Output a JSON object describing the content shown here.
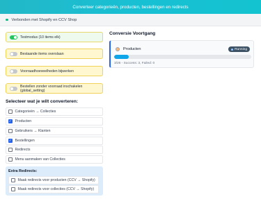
{
  "header": {
    "title": "Converteer categorieën, producten, bestellingen en redirects"
  },
  "connection": {
    "status_text": "Verbonden met Shopify en CCV Shop"
  },
  "settings": [
    {
      "label": "Testmodus (10 items elk)",
      "enabled": true
    },
    {
      "label": "Bestaande items overslaan",
      "enabled": false
    },
    {
      "label": "Voorraadhoeveelheden bijwerken",
      "enabled": false
    },
    {
      "label": "Bestellen zonder voorraad inschakelen (global_setting)",
      "enabled": false
    }
  ],
  "selection": {
    "title": "Selecteer wat je wilt converteren:",
    "options": [
      {
        "label": "Categorieën → Collecties",
        "checked": false
      },
      {
        "label": "Producten",
        "checked": true
      },
      {
        "label": "Gebruikers → Klanten",
        "checked": false
      },
      {
        "label": "Bestellingen",
        "checked": true
      },
      {
        "label": "Redirects",
        "checked": false
      },
      {
        "label": "Menu aanmaken van Collecties",
        "checked": false
      }
    ]
  },
  "extra_redirects": {
    "title": "Extra Redirects:",
    "options": [
      {
        "label": "Maak redirects voor producten (CCV → Shopify)",
        "checked": false
      },
      {
        "label": "Maak redirects voor collecties (CCV → Shopify)",
        "checked": false
      }
    ]
  },
  "conversion": {
    "title": "Conversie Voortgang",
    "task": {
      "label": "Producten",
      "status": "Running",
      "progress": 0.108,
      "stats": "3/26 - Success: 3, Failed: 0"
    }
  },
  "colors": {
    "header_start": "#22b8c8",
    "header_end": "#13c3cf",
    "connected_dot": "#10b981",
    "toggle_on": "#22c55e",
    "card_border": "#f0d259",
    "checkbox_checked": "#2563eb",
    "progress_fill": "#0ea5e9",
    "badge_bg": "#3e5266"
  },
  "icons": {
    "connected": "status-dot-icon",
    "task": "product-box-icon",
    "check": "checkmark-icon"
  }
}
